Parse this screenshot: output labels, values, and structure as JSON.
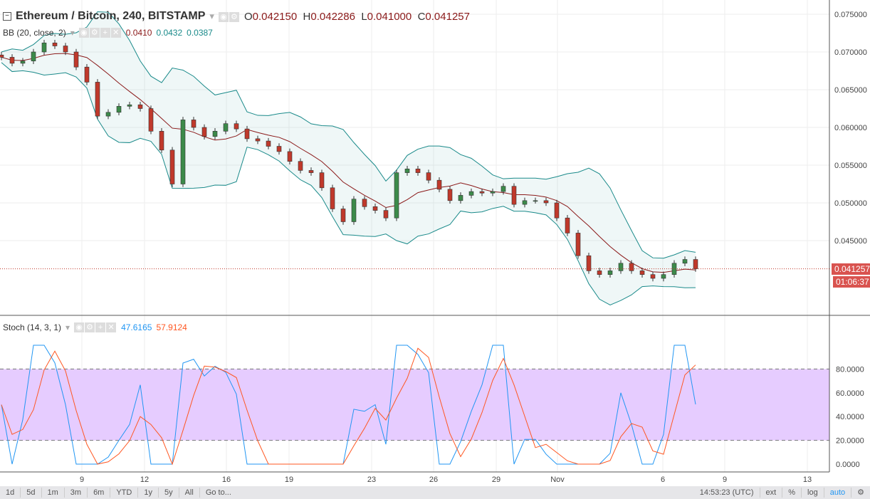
{
  "header": {
    "symbol": "Ethereum / Bitcoin, 240, BITSTAMP",
    "o_label": "O",
    "o": "0.042150",
    "h_label": "H",
    "h": "0.042286",
    "l_label": "L",
    "l": "0.041000",
    "c_label": "C",
    "c": "0.041257"
  },
  "bb": {
    "label": "BB (20, close, 2)",
    "basis": "0.0410",
    "upper": "0.0432",
    "lower": "0.0387"
  },
  "stoch": {
    "label": "Stoch (14, 3, 1)",
    "k": "47.6165",
    "d": "57.9124"
  },
  "price_tag": "0.041257",
  "countdown": "01:06:37",
  "colors": {
    "up": "#3c8a4a",
    "down": "#c0392b",
    "bb_band": "#1a8a8a",
    "bb_basis": "#8b1a1a",
    "k": "#2196f3",
    "d": "#ff5722",
    "stoch_fill": "#e6ccff"
  },
  "chart_data": {
    "type": "candlestick",
    "price_ticks": [
      "0.075000",
      "0.070000",
      "0.065000",
      "0.060000",
      "0.055000",
      "0.050000",
      "0.045000"
    ],
    "price_range": [
      0.0365,
      0.0769
    ],
    "stoch_ticks": [
      "80.0000",
      "60.0000",
      "40.0000",
      "20.0000",
      "0.0000"
    ],
    "time_ticks": [
      "9",
      "12",
      "16",
      "19",
      "23",
      "26",
      "29",
      "Nov",
      "6",
      "9",
      "13"
    ],
    "closes": [
      0.0693,
      0.0685,
      0.0688,
      0.07,
      0.0712,
      0.0708,
      0.07,
      0.068,
      0.066,
      0.0615,
      0.062,
      0.0628,
      0.063,
      0.0625,
      0.0595,
      0.057,
      0.0525,
      0.061,
      0.06,
      0.0588,
      0.0595,
      0.0605,
      0.0598,
      0.0585,
      0.0582,
      0.0575,
      0.0568,
      0.0555,
      0.0543,
      0.054,
      0.052,
      0.0492,
      0.0475,
      0.0505,
      0.0495,
      0.049,
      0.048,
      0.054,
      0.0545,
      0.054,
      0.053,
      0.0518,
      0.0503,
      0.051,
      0.0515,
      0.0513,
      0.0515,
      0.0522,
      0.0498,
      0.0503,
      0.0503,
      0.05,
      0.048,
      0.046,
      0.043,
      0.041,
      0.0405,
      0.041,
      0.042,
      0.041,
      0.0405,
      0.04,
      0.0405,
      0.042,
      0.0425,
      0.041257
    ]
  },
  "toolbar": {
    "ranges": [
      "1d",
      "5d",
      "1m",
      "3m",
      "6m",
      "YTD",
      "1y",
      "5y",
      "All"
    ],
    "goto": "Go to...",
    "time": "14:53:23 (UTC)",
    "ext": "ext",
    "pct": "%",
    "log": "log",
    "auto": "auto"
  }
}
